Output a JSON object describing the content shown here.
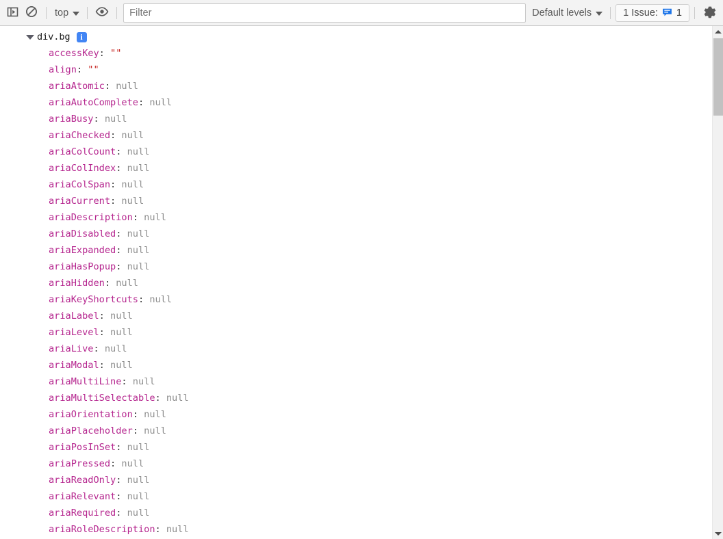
{
  "toolbar": {
    "sidebar_toggle_title": "Show console sidebar",
    "clear_title": "Clear console",
    "context_label": "top",
    "eye_title": "Create live expression",
    "filter_placeholder": "Filter",
    "filter_value": "",
    "levels_label": "Default levels",
    "issues_label": "1 Issue:",
    "issues_count": "1",
    "settings_title": "Settings",
    "icons": {
      "sidebar": "console-sidebar-icon",
      "clear": "clear-console-icon",
      "eye": "eye-icon",
      "issues": "issues-bubble-icon",
      "settings": "gear-icon"
    },
    "colors": {
      "accent_blue": "#4285f4",
      "toolbar_bg": "#f3f3f3",
      "toolbar_border": "#cdcdcd",
      "text": "#5a5a5a"
    }
  },
  "console": {
    "object_label": "div.bg",
    "info_badge": "i",
    "clipped_row_text": "",
    "properties": [
      {
        "name": "accessKey",
        "value": "\"\"",
        "type": "string"
      },
      {
        "name": "align",
        "value": "\"\"",
        "type": "string"
      },
      {
        "name": "ariaAtomic",
        "value": "null",
        "type": "null"
      },
      {
        "name": "ariaAutoComplete",
        "value": "null",
        "type": "null"
      },
      {
        "name": "ariaBusy",
        "value": "null",
        "type": "null"
      },
      {
        "name": "ariaChecked",
        "value": "null",
        "type": "null"
      },
      {
        "name": "ariaColCount",
        "value": "null",
        "type": "null"
      },
      {
        "name": "ariaColIndex",
        "value": "null",
        "type": "null"
      },
      {
        "name": "ariaColSpan",
        "value": "null",
        "type": "null"
      },
      {
        "name": "ariaCurrent",
        "value": "null",
        "type": "null"
      },
      {
        "name": "ariaDescription",
        "value": "null",
        "type": "null"
      },
      {
        "name": "ariaDisabled",
        "value": "null",
        "type": "null"
      },
      {
        "name": "ariaExpanded",
        "value": "null",
        "type": "null"
      },
      {
        "name": "ariaHasPopup",
        "value": "null",
        "type": "null"
      },
      {
        "name": "ariaHidden",
        "value": "null",
        "type": "null"
      },
      {
        "name": "ariaKeyShortcuts",
        "value": "null",
        "type": "null"
      },
      {
        "name": "ariaLabel",
        "value": "null",
        "type": "null"
      },
      {
        "name": "ariaLevel",
        "value": "null",
        "type": "null"
      },
      {
        "name": "ariaLive",
        "value": "null",
        "type": "null"
      },
      {
        "name": "ariaModal",
        "value": "null",
        "type": "null"
      },
      {
        "name": "ariaMultiLine",
        "value": "null",
        "type": "null"
      },
      {
        "name": "ariaMultiSelectable",
        "value": "null",
        "type": "null"
      },
      {
        "name": "ariaOrientation",
        "value": "null",
        "type": "null"
      },
      {
        "name": "ariaPlaceholder",
        "value": "null",
        "type": "null"
      },
      {
        "name": "ariaPosInSet",
        "value": "null",
        "type": "null"
      },
      {
        "name": "ariaPressed",
        "value": "null",
        "type": "null"
      },
      {
        "name": "ariaReadOnly",
        "value": "null",
        "type": "null"
      },
      {
        "name": "ariaRelevant",
        "value": "null",
        "type": "null"
      },
      {
        "name": "ariaRequired",
        "value": "null",
        "type": "null"
      },
      {
        "name": "ariaRoleDescription",
        "value": "null",
        "type": "null"
      }
    ],
    "colors": {
      "property_name": "#b5258e",
      "value_null": "#8d8d8d",
      "value_string": "#c5221f",
      "object_label": "#1a1a1a"
    }
  },
  "scrollbar": {
    "up_arrow": "scroll-up-arrow",
    "down_arrow": "scroll-down-arrow",
    "thumb": "scroll-thumb"
  }
}
